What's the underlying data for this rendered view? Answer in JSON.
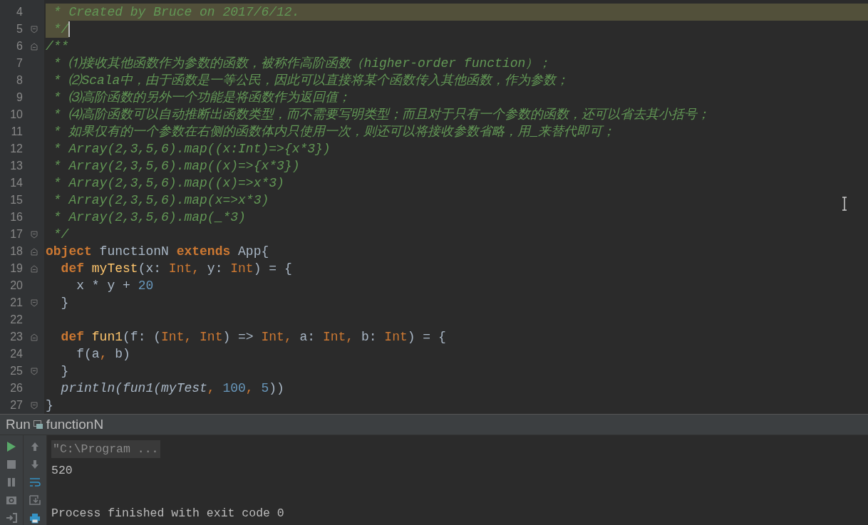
{
  "editor": {
    "lines": [
      {
        "number": "4",
        "highlighted": true,
        "tokens": [
          {
            "kind": "comment",
            "text": " * Created by Bruce on 2017/6/12."
          }
        ]
      },
      {
        "number": "5",
        "highlighted": true,
        "caret": true,
        "fold_end": true,
        "tokens": [
          {
            "kind": "comment",
            "text": " */"
          }
        ]
      },
      {
        "number": "6",
        "fold_start": true,
        "tokens": [
          {
            "kind": "comment",
            "text": "/**"
          }
        ]
      },
      {
        "number": "7",
        "tokens": [
          {
            "kind": "comment",
            "text": " * ⑴接收其他函数作为参数的函数，被称作高阶函数（higher-order function）；"
          }
        ]
      },
      {
        "number": "8",
        "tokens": [
          {
            "kind": "comment",
            "text": " * ⑵Scala中，由于函数是一等公民，因此可以直接将某个函数传入其他函数，作为参数；"
          }
        ]
      },
      {
        "number": "9",
        "tokens": [
          {
            "kind": "comment",
            "text": " * ⑶高阶函数的另外一个功能是将函数作为返回值；"
          }
        ]
      },
      {
        "number": "10",
        "tokens": [
          {
            "kind": "comment",
            "text": " * ⑷高阶函数可以自动推断出函数类型，而不需要写明类型；而且对于只有一个参数的函数，还可以省去其小括号；"
          }
        ]
      },
      {
        "number": "11",
        "tokens": [
          {
            "kind": "comment",
            "text": " * 如果仅有的一个参数在右侧的函数体内只使用一次，则还可以将接收参数省略，用_来替代即可；"
          }
        ]
      },
      {
        "number": "12",
        "tokens": [
          {
            "kind": "comment",
            "text": " * Array(2,3,5,6).map((x:Int)=>{x*3})"
          }
        ]
      },
      {
        "number": "13",
        "tokens": [
          {
            "kind": "comment",
            "text": " * Array(2,3,5,6).map((x)=>{x*3})"
          }
        ]
      },
      {
        "number": "14",
        "tokens": [
          {
            "kind": "comment",
            "text": " * Array(2,3,5,6).map((x)=>x*3)"
          }
        ]
      },
      {
        "number": "15",
        "tokens": [
          {
            "kind": "comment",
            "text": " * Array(2,3,5,6).map(x=>x*3)"
          }
        ]
      },
      {
        "number": "16",
        "tokens": [
          {
            "kind": "comment",
            "text": " * Array(2,3,5,6).map(_*3)"
          }
        ]
      },
      {
        "number": "17",
        "fold_end": true,
        "tokens": [
          {
            "kind": "comment",
            "text": " */"
          }
        ]
      },
      {
        "number": "18",
        "fold_start": true,
        "tokens": [
          {
            "kind": "keyword",
            "text": "object"
          },
          {
            "kind": "plain",
            "text": " functionN "
          },
          {
            "kind": "keyword",
            "text": "extends"
          },
          {
            "kind": "plain",
            "text": " App{"
          }
        ]
      },
      {
        "number": "19",
        "fold_start": true,
        "tokens": [
          {
            "kind": "keyword",
            "text": "  def "
          },
          {
            "kind": "function",
            "text": "myTest"
          },
          {
            "kind": "plain",
            "text": "(x: "
          },
          {
            "kind": "type",
            "text": "Int, "
          },
          {
            "kind": "plain",
            "text": "y: "
          },
          {
            "kind": "type",
            "text": "Int"
          },
          {
            "kind": "plain",
            "text": ") = {"
          }
        ]
      },
      {
        "number": "20",
        "tokens": [
          {
            "kind": "plain",
            "text": "    x * y + "
          },
          {
            "kind": "number",
            "text": "20"
          }
        ]
      },
      {
        "number": "21",
        "fold_end": true,
        "tokens": [
          {
            "kind": "plain",
            "text": "  }"
          }
        ]
      },
      {
        "number": "22"
      },
      {
        "number": "23",
        "fold_start": true,
        "tokens": [
          {
            "kind": "keyword",
            "text": "  def "
          },
          {
            "kind": "function",
            "text": "fun1"
          },
          {
            "kind": "plain",
            "text": "(f: ("
          },
          {
            "kind": "type",
            "text": "Int, Int"
          },
          {
            "kind": "plain",
            "text": ") => "
          },
          {
            "kind": "type",
            "text": "Int, "
          },
          {
            "kind": "plain",
            "text": "a: "
          },
          {
            "kind": "type",
            "text": "Int, "
          },
          {
            "kind": "plain",
            "text": "b: "
          },
          {
            "kind": "type",
            "text": "Int"
          },
          {
            "kind": "plain",
            "text": ") = {"
          }
        ]
      },
      {
        "number": "24",
        "tokens": [
          {
            "kind": "plain",
            "text": "    f(a"
          },
          {
            "kind": "type",
            "text": ", "
          },
          {
            "kind": "plain",
            "text": "b)"
          }
        ]
      },
      {
        "number": "25",
        "fold_end": true,
        "tokens": [
          {
            "kind": "plain",
            "text": "  }"
          }
        ]
      },
      {
        "number": "26",
        "tokens": [
          {
            "kind": "call",
            "text": "  println(fun1(myTest"
          },
          {
            "kind": "type",
            "text": ", "
          },
          {
            "kind": "number",
            "text": "100"
          },
          {
            "kind": "type",
            "text": ", "
          },
          {
            "kind": "number",
            "text": "5"
          },
          {
            "kind": "plain",
            "text": "))"
          }
        ]
      },
      {
        "number": "27",
        "fold_end": true,
        "tokens": [
          {
            "kind": "plain",
            "text": "}"
          }
        ]
      }
    ]
  },
  "run_panel": {
    "label": "Run",
    "config": "functionN",
    "left_tools": [
      {
        "kind": "play",
        "disabled": false
      },
      {
        "kind": "stop",
        "disabled": true
      },
      {
        "kind": "pause",
        "disabled": true
      },
      {
        "kind": "camera",
        "disabled": true
      },
      {
        "kind": "exit",
        "disabled": true
      }
    ],
    "right_tools": [
      {
        "kind": "up",
        "disabled": true
      },
      {
        "kind": "down",
        "disabled": true
      },
      {
        "kind": "wrap",
        "disabled": false
      },
      {
        "kind": "export",
        "disabled": true
      },
      {
        "kind": "print",
        "disabled": false
      }
    ],
    "console": [
      {
        "text": "\"C:\\Program ...",
        "folded": true
      },
      {
        "text": "520",
        "folded": false
      },
      {
        "text": "Process finished with exit code 0",
        "folded": false
      }
    ]
  }
}
